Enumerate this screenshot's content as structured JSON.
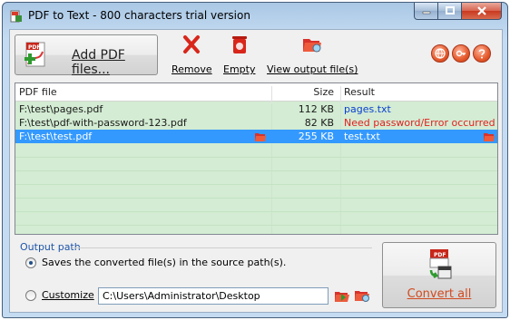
{
  "window": {
    "title": "PDF to Text - 800 characters trial version"
  },
  "toolbar": {
    "add_label": "Add PDF files...",
    "remove_label": "Remove",
    "empty_label": "Empty",
    "view_output_label": "View output file(s)",
    "pdf_badge": "PDF"
  },
  "list": {
    "headers": {
      "file": "PDF file",
      "size": "Size",
      "result": "Result"
    },
    "rows": [
      {
        "file": "F:\\test\\pages.pdf",
        "size": "112 KB",
        "result": "pages.txt",
        "status": "ok"
      },
      {
        "file": "F:\\test\\pdf-with-password-123.pdf",
        "size": "82 KB",
        "result": "Need password/Error occurred",
        "status": "error"
      },
      {
        "file": "F:\\test\\test.pdf",
        "size": "255 KB",
        "result": "test.txt",
        "status": "selected"
      }
    ]
  },
  "output": {
    "title": "Output path",
    "source_option": "Saves the converted file(s) in the source path(s).",
    "customize_option": "Customize",
    "customize_path": "C:\\Users\\Administrator\\Desktop",
    "selected": "source"
  },
  "convert": {
    "label": "Convert all",
    "pdf_badge": "PDF"
  },
  "colors": {
    "list_bg": "#d3ecd3",
    "selection": "#3399ff",
    "result_ok": "#0a3fd0",
    "result_error": "#e21f1f",
    "accent": "#d24a1f"
  },
  "icons": {
    "round_buttons": [
      "web-icon",
      "key-icon",
      "help-icon"
    ]
  }
}
